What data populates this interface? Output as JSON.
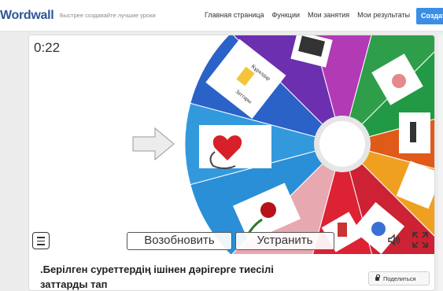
{
  "header": {
    "logo": "Wordwall",
    "tagline": "Быстрее создавайте лучшие уроки",
    "nav": [
      "Главная страница",
      "Функции",
      "Мои занятия",
      "Мои результаты"
    ],
    "create_label": "Создат"
  },
  "activity": {
    "timer": "0:22",
    "resume_label": "Возобновить",
    "remove_label": "Устранить",
    "title": ".Берілген суреттердің ішінен дәрігерге тиесілі заттарды тап",
    "share_label": "Поделиться",
    "segment_caption_1": "Кұралдар",
    "segment_caption_2": "Заттары"
  },
  "colors": {
    "wheel_segments": [
      "#3399dd",
      "#2a62c8",
      "#6b2fb0",
      "#b33ab5",
      "#2e9e4a",
      "#229944",
      "#e05a1a",
      "#f0a020",
      "#cc2233",
      "#dd2233",
      "#e8a8b0",
      "#2a8fd6"
    ],
    "accent": "#3a8ee6"
  }
}
